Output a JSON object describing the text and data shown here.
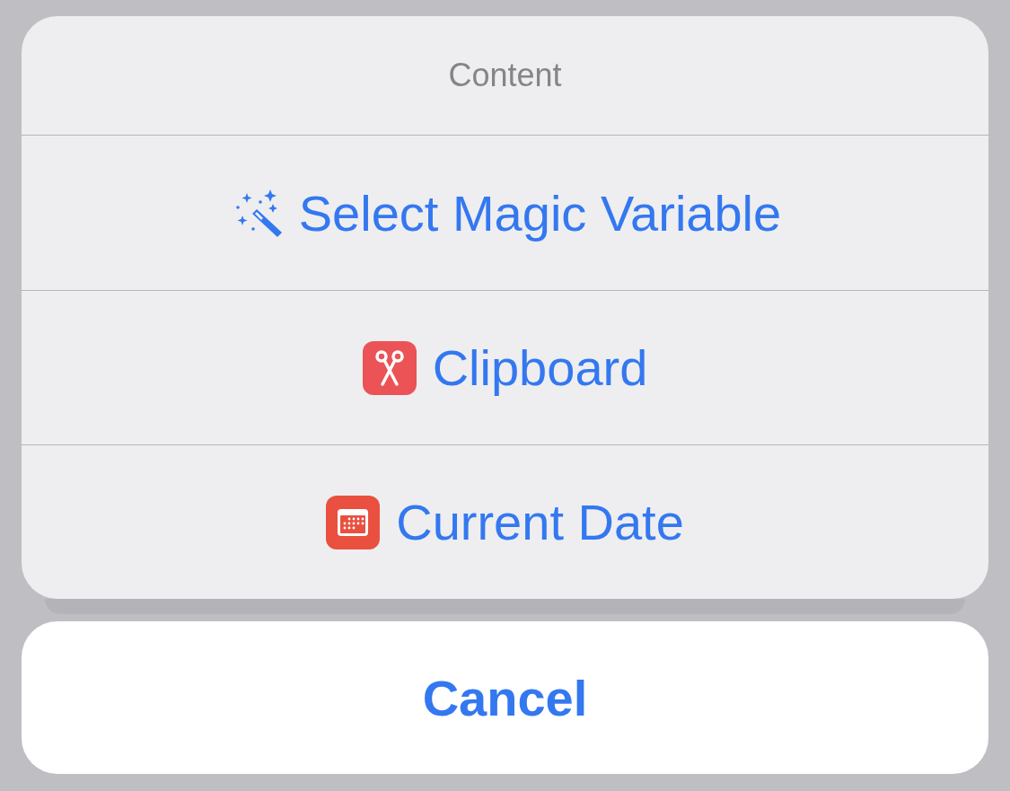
{
  "action_sheet": {
    "title": "Content",
    "items": [
      {
        "kind": "wand",
        "label": "Select Magic Variable"
      },
      {
        "kind": "scissors",
        "label": "Clipboard"
      },
      {
        "kind": "calendar",
        "label": "Current Date"
      }
    ]
  },
  "cancel_button": {
    "label": "Cancel"
  }
}
